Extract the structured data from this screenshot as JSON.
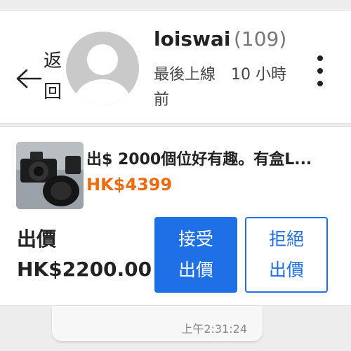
{
  "header": {
    "back_label": "返回",
    "username": "loiswai",
    "rating": "(109)",
    "last_seen": "最後上線",
    "last_seen_time": "10 小時前"
  },
  "offer": {
    "item_title": "出$ 2000個位好有趣。有盒L...",
    "item_price": "HK$4399",
    "offer_label": "出價",
    "offer_amount": "HK$2200.00",
    "accept_line1": "接受",
    "accept_line2": "出價",
    "reject_line1": "拒絕",
    "reject_line2": "出價"
  },
  "chat": {
    "message_time": "上午2:31:24"
  },
  "colors": {
    "accent": "#1f6fe6",
    "price": "#f06a0f"
  },
  "icons": {
    "back": "arrow-left-icon",
    "more": "more-vertical-icon"
  }
}
